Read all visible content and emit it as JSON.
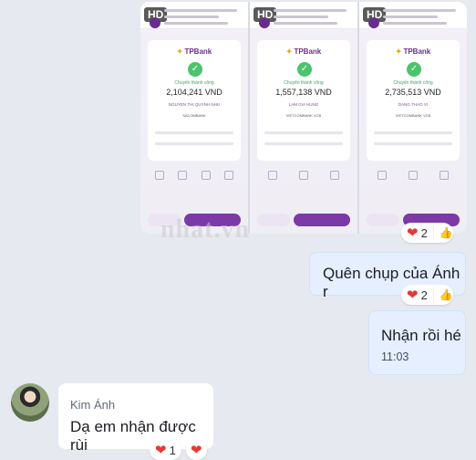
{
  "shots": [
    {
      "hd": "HD",
      "logo": "TPBank",
      "status": "Chuyển thành công",
      "amount": "2,104,241 VND",
      "recipient": "NGUYEN THI QUYNH NHU",
      "bank": "SACOMBANK"
    },
    {
      "hd": "HD",
      "logo": "TPBank",
      "status": "Chuyển thành công",
      "amount": "1,557,138 VND",
      "recipient": "LAM GIA HUNG",
      "bank": "VIETCOMBANK VCB"
    },
    {
      "hd": "HD",
      "logo": "TPBank",
      "status": "Chuyển thành công",
      "amount": "2,735,513 VND",
      "recipient": "DANG THAO VI",
      "bank": "VIETCOMBANK VCB"
    }
  ],
  "photo_reaction": {
    "heart": "❤",
    "count": "2",
    "like": "👍"
  },
  "messages": [
    {
      "text": "Quên chụp của Ánh r",
      "reaction_count": "2"
    },
    {
      "text": "Nhận rồi hé",
      "time": "11:03"
    },
    {
      "sender": "Kim Ánh",
      "text": "Dạ em nhận được rùi",
      "reaction_count": "1"
    }
  ],
  "watermark": "nhat.vn",
  "colors": {
    "mine_bubble": "#e5efff",
    "theirs_bubble": "#ffffff",
    "heart": "#e53935",
    "brand": "#6b2f8d"
  }
}
